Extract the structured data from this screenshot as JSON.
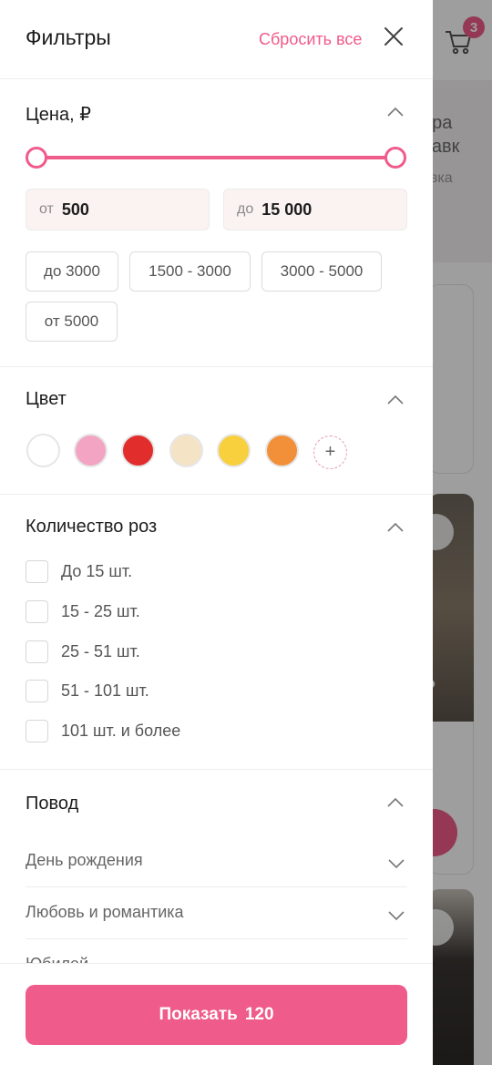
{
  "background": {
    "cart_count": "3",
    "banner_text": "тра",
    "banner_text2": "тавк",
    "banner_sub": "авка",
    "banner_sub2": "т",
    "card_price": "о"
  },
  "header": {
    "title": "Фильтры",
    "reset_label": "Сбросить все"
  },
  "price": {
    "title": "Цена, ₽",
    "from_label": "от",
    "from_value": "500",
    "to_label": "до",
    "to_value": "15 000",
    "presets": [
      "до 3000",
      "1500 - 3000",
      "3000 - 5000",
      "от 5000"
    ]
  },
  "color": {
    "title": "Цвет",
    "swatches": [
      "#ffffff",
      "#f2a4c2",
      "#e22d2d",
      "#f5e3c6",
      "#f8cf3c",
      "#f2903a"
    ]
  },
  "roses": {
    "title": "Количество роз",
    "options": [
      "До 15 шт.",
      "15 - 25 шт.",
      "25 - 51 шт.",
      "51 - 101 шт.",
      "101 шт. и более"
    ]
  },
  "occasion": {
    "title": "Повод",
    "items": [
      "День рождения",
      "Любовь и романтика",
      "Юбилей"
    ]
  },
  "footer": {
    "show_label": "Показать",
    "count": "120"
  },
  "colors": {
    "accent": "#ef5b8a",
    "input_bg": "#fbf2f2"
  }
}
